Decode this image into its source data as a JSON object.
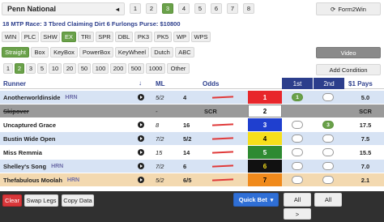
{
  "track": {
    "name": "Penn National",
    "arrow": "◂"
  },
  "race_tabs": [
    "1",
    "2",
    "3",
    "4",
    "5",
    "6",
    "7",
    "8"
  ],
  "race_active": "3",
  "app_button": "Form2Win",
  "race_info": "18 MTP Race: 3 Tbred Claiming Dirt 6 Furlongs Purse: $10800",
  "bet_types": [
    "WIN",
    "PLC",
    "SHW",
    "EX",
    "TRI",
    "SPR",
    "DBL",
    "PK3",
    "PK5",
    "WP",
    "WPS"
  ],
  "bet_active": "EX",
  "modes": [
    "Straight",
    "Box",
    "KeyBox",
    "PowerBox",
    "KeyWheel",
    "Dutch",
    "ABC"
  ],
  "mode_active": "Straight",
  "video_label": "Video",
  "add_condition_label": "Add Condition",
  "amounts": [
    "1",
    "2",
    "3",
    "5",
    "10",
    "20",
    "50",
    "100",
    "200",
    "500",
    "1000",
    "Other"
  ],
  "amount_active": "2",
  "headers": {
    "runner": "Runner",
    "sort": "↓",
    "ml": "ML",
    "odds": "Odds",
    "first": "1st",
    "second": "2nd",
    "pays": "$1 Pays"
  },
  "rows": [
    {
      "name": "Anotherworldinside",
      "hrn": "HRN",
      "ml": "5/2",
      "odds": "4",
      "pp": "1",
      "pp_bg": "#e8262b",
      "pp_fg": "#ffffff",
      "first": "1",
      "second": "",
      "pays": "5.0"
    },
    {
      "name": "Skipover",
      "hrn": "",
      "ml": "-",
      "odds": "SCR",
      "pp": "2",
      "pp_bg": "#ffffff",
      "pp_fg": "#000000",
      "first": "",
      "second": "",
      "pays": "SCR"
    },
    {
      "name": "Uncaptured Grace",
      "hrn": "",
      "ml": "8",
      "odds": "16",
      "pp": "3",
      "pp_bg": "#1f3fcf",
      "pp_fg": "#ffffff",
      "first": "",
      "second": "3",
      "pays": "17.5"
    },
    {
      "name": "Bustin Wide Open",
      "hrn": "",
      "ml": "7/2",
      "odds": "5/2",
      "pp": "4",
      "pp_bg": "#f6df1b",
      "pp_fg": "#000000",
      "first": "",
      "second": "",
      "pays": "7.5"
    },
    {
      "name": "Miss Remmia",
      "hrn": "",
      "ml": "15",
      "odds": "14",
      "pp": "5",
      "pp_bg": "#2e8a32",
      "pp_fg": "#ffffff",
      "first": "",
      "second": "",
      "pays": "15.5"
    },
    {
      "name": "Shelley's Song",
      "hrn": "HRN",
      "ml": "7/2",
      "odds": "6",
      "pp": "6",
      "pp_bg": "#111111",
      "pp_fg": "#f6df1b",
      "first": "",
      "second": "",
      "pays": "7.0"
    },
    {
      "name": "Thefabulous Moolah",
      "hrn": "HRN",
      "ml": "5/2",
      "odds": "6/5",
      "pp": "7",
      "pp_bg": "#f08a1c",
      "pp_fg": "#000000",
      "first": "",
      "second": "",
      "pays": "2.1"
    }
  ],
  "footer": {
    "clear": "Clear",
    "swap": "Swap Legs",
    "copy": "Copy Data",
    "quick_bet": "Quick Bet",
    "all1": "All",
    "all2": "All",
    "next": ">"
  },
  "colors": {
    "accent_green": "#6aa14a",
    "header_blue": "#2c3e8c",
    "clear_red": "#d9373a",
    "quickbet_blue": "#2f6fd6",
    "dark": "#303030"
  }
}
